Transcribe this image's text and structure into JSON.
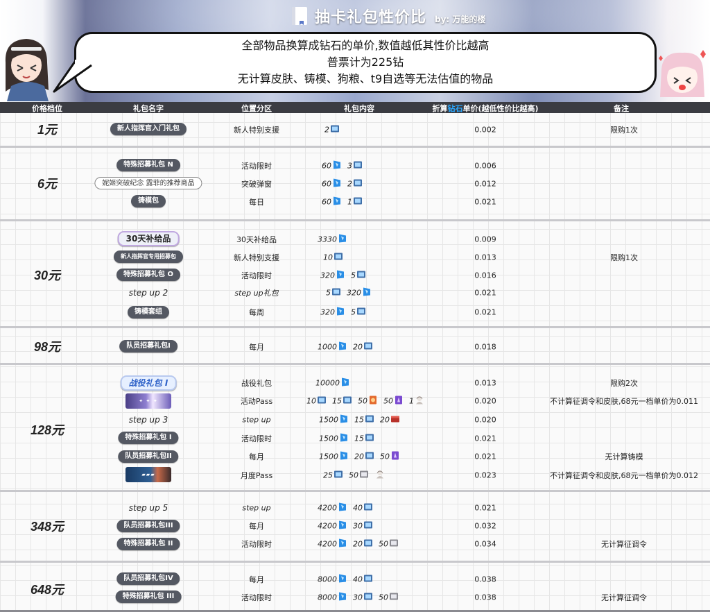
{
  "header_bar": {
    "title": "抽卡礼包性价比",
    "byline": "by: 万能的楼"
  },
  "bubble": {
    "line1": "全部物品换算成钻石的单价,数值越低其性价比越高",
    "line2": "普票计为225钻",
    "line3": "无计算皮肤、铸模、狗粮、t9自选等无法估值的物品"
  },
  "columns": {
    "price": "价格档位",
    "name": "礼包名字",
    "location": "位置分区",
    "content": "礼包内容",
    "unit_prefix": "折算",
    "unit_hl": "钻石",
    "unit_suffix": "单价(越低性价比越高)",
    "note": "备注"
  },
  "tiers": [
    {
      "price": "1元"
    },
    {
      "price": "6元"
    },
    {
      "price": "30元"
    },
    {
      "price": "98元"
    },
    {
      "price": "128元"
    },
    {
      "price": "348元"
    },
    {
      "price": "648元"
    }
  ],
  "rows": [
    {
      "name": "新人指挥官入门礼包",
      "location": "新人特别支援",
      "unit": "0.002",
      "note": "限购1次",
      "items": [
        {
          "n": "2",
          "icon": "ticket-icon"
        }
      ]
    },
    {
      "name": "特殊招募礼包 N",
      "location": "活动限时",
      "unit": "0.006",
      "note": "",
      "items": [
        {
          "n": "60",
          "icon": "gem-icon"
        },
        {
          "n": "3",
          "icon": "ticket-icon"
        }
      ]
    },
    {
      "name": "妮姬突破纪念 露菲的推荐商品",
      "location": "突破弹窗",
      "unit": "0.012",
      "note": "",
      "items": [
        {
          "n": "60",
          "icon": "gem-icon"
        },
        {
          "n": "2",
          "icon": "ticket-icon"
        }
      ]
    },
    {
      "name": "铸模包",
      "location": "每日",
      "unit": "0.021",
      "note": "",
      "items": [
        {
          "n": "60",
          "icon": "gem-icon"
        },
        {
          "n": "1",
          "icon": "ticket-icon"
        }
      ]
    },
    {
      "name": "30天补给品",
      "location": "30天补给品",
      "unit": "0.009",
      "note": "",
      "items": [
        {
          "n": "3330",
          "icon": "gem-icon"
        }
      ]
    },
    {
      "name": "新人指挥官专用招募包",
      "location": "新人特别支援",
      "unit": "0.013",
      "note": "限购1次",
      "items": [
        {
          "n": "10",
          "icon": "ticket-icon"
        }
      ]
    },
    {
      "name": "特殊招募礼包 O",
      "location": "活动限时",
      "unit": "0.016",
      "note": "",
      "items": [
        {
          "n": "320",
          "icon": "gem-icon"
        },
        {
          "n": "5",
          "icon": "ticket-icon"
        }
      ]
    },
    {
      "name": "step up 2",
      "location": "step up礼包",
      "unit": "0.021",
      "note": "",
      "items": [
        {
          "n": "5",
          "icon": "ticket-icon"
        },
        {
          "n": "320",
          "icon": "gem-icon"
        }
      ]
    },
    {
      "name": "铸模套组",
      "location": "每周",
      "unit": "0.021",
      "note": "",
      "items": [
        {
          "n": "320",
          "icon": "gem-icon"
        },
        {
          "n": "5",
          "icon": "ticket-icon"
        }
      ]
    },
    {
      "name": "队员招募礼包I",
      "location": "每月",
      "unit": "0.018",
      "note": "",
      "items": [
        {
          "n": "1000",
          "icon": "gem-icon"
        },
        {
          "n": "20",
          "icon": "ticket-icon"
        }
      ]
    },
    {
      "name": "战役礼包 I",
      "location": "战役礼包",
      "unit": "0.013",
      "note": "限购2次",
      "items": [
        {
          "n": "10000",
          "icon": "gem-icon"
        }
      ]
    },
    {
      "name": "",
      "location": "活动Pass",
      "unit": "0.020",
      "note": "不计算征调令和皮肤,68元一档单价为0.011",
      "items": [
        {
          "n": "10",
          "icon": "ticket-icon"
        },
        {
          "n": "15",
          "icon": "ticket-icon"
        },
        {
          "n": "50",
          "icon": "orange-card-icon"
        },
        {
          "n": "50",
          "icon": "purple-card-icon"
        },
        {
          "n": "1",
          "icon": "character-skin-icon"
        }
      ]
    },
    {
      "name": "step up 3",
      "location": "step up",
      "unit": "0.020",
      "note": "",
      "items": [
        {
          "n": "1500",
          "icon": "gem-icon"
        },
        {
          "n": "15",
          "icon": "ticket-icon"
        },
        {
          "n": "20",
          "icon": "red-box-icon"
        }
      ]
    },
    {
      "name": "特殊招募礼包 I",
      "location": "活动限时",
      "unit": "0.021",
      "note": "",
      "items": [
        {
          "n": "1500",
          "icon": "gem-icon"
        },
        {
          "n": "15",
          "icon": "ticket-icon"
        }
      ]
    },
    {
      "name": "队员招募礼包II",
      "location": "每月",
      "unit": "0.021",
      "note": "无计算铸模",
      "items": [
        {
          "n": "1500",
          "icon": "gem-icon"
        },
        {
          "n": "20",
          "icon": "ticket-icon"
        },
        {
          "n": "50",
          "icon": "purple-card-icon"
        }
      ]
    },
    {
      "name": "",
      "location": "月度Pass",
      "unit": "0.023",
      "note": "不计算征调令和皮肤,68元一档单价为0.012",
      "items": [
        {
          "n": "25",
          "icon": "ticket-icon"
        },
        {
          "n": "50",
          "icon": "silver-box-icon"
        },
        {
          "n": "",
          "icon": "character-skin-icon"
        }
      ]
    },
    {
      "name": "step up 5",
      "location": "step up",
      "unit": "0.021",
      "note": "",
      "items": [
        {
          "n": "4200",
          "icon": "gem-icon"
        },
        {
          "n": "40",
          "icon": "ticket-icon"
        }
      ]
    },
    {
      "name": "队员招募礼包III",
      "location": "每月",
      "unit": "0.032",
      "note": "",
      "items": [
        {
          "n": "4200",
          "icon": "gem-icon"
        },
        {
          "n": "30",
          "icon": "ticket-icon"
        }
      ]
    },
    {
      "name": "特殊招募礼包 II",
      "location": "活动限时",
      "unit": "0.034",
      "note": "无计算征调令",
      "items": [
        {
          "n": "4200",
          "icon": "gem-icon"
        },
        {
          "n": "20",
          "icon": "ticket-icon"
        },
        {
          "n": "50",
          "icon": "silver-box-icon"
        }
      ]
    },
    {
      "name": "队员招募礼包IV",
      "location": "每月",
      "unit": "0.038",
      "note": "",
      "items": [
        {
          "n": "8000",
          "icon": "gem-icon"
        },
        {
          "n": "40",
          "icon": "ticket-icon"
        }
      ]
    },
    {
      "name": "特殊招募礼包 III",
      "location": "活动限时",
      "unit": "0.038",
      "note": "无计算征调令",
      "items": [
        {
          "n": "8000",
          "icon": "gem-icon"
        },
        {
          "n": "30",
          "icon": "ticket-icon"
        },
        {
          "n": "50",
          "icon": "silver-box-icon"
        }
      ]
    }
  ],
  "colors": {
    "header_bg": "#3b3c42",
    "diamond_highlight": "#2aa8ff",
    "pill_bg": "#545862"
  }
}
